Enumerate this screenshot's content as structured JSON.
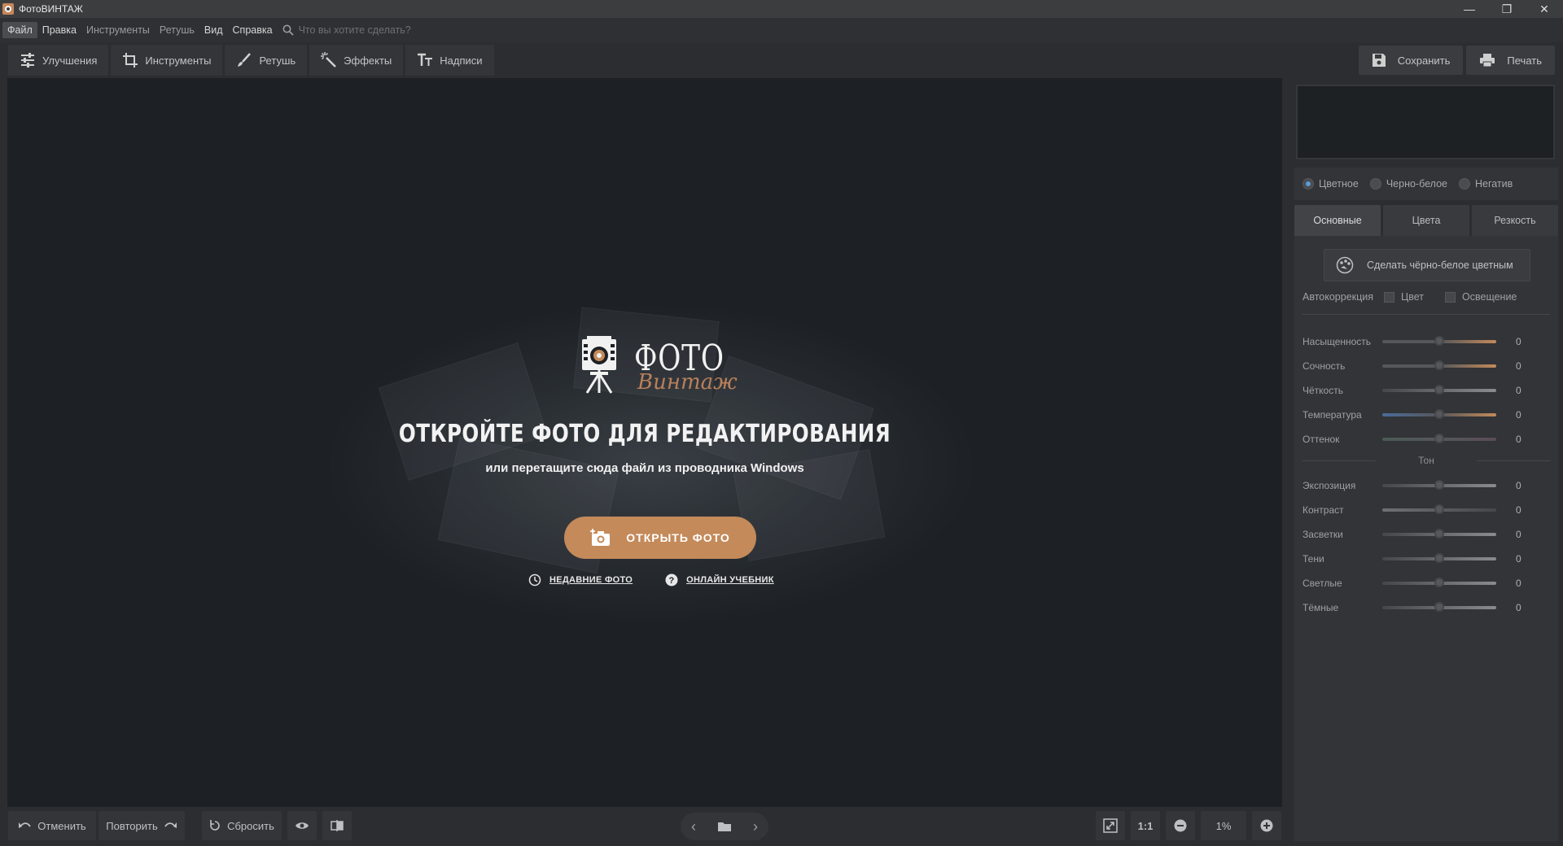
{
  "window": {
    "title": "ФотоВИНТАЖ"
  },
  "menu": {
    "items": [
      "Файл",
      "Правка",
      "Инструменты",
      "Ретушь",
      "Вид",
      "Справка"
    ],
    "search_placeholder": "Что вы хотите сделать?"
  },
  "tabs": [
    "Улучшения",
    "Инструменты",
    "Ретушь",
    "Эффекты",
    "Надписи"
  ],
  "actions": {
    "save": "Сохранить",
    "print": "Печать"
  },
  "welcome": {
    "logo_top": "ФОТО",
    "logo_bottom": "Винтаж",
    "headline": "ОТКРОЙТЕ ФОТО ДЛЯ РЕДАКТИРОВАНИЯ",
    "subline": "или перетащите сюда файл из проводника Windows",
    "open_button": "ОТКРЫТЬ ФОТО",
    "recent_link": "НЕДАВНИЕ ФОТО",
    "tutorial_link": "ОНЛАЙН УЧЕБНИК"
  },
  "bottom": {
    "undo": "Отменить",
    "redo": "Повторить",
    "reset": "Сбросить",
    "ratio": "1:1",
    "zoom": "1%"
  },
  "panel": {
    "modes": [
      "Цветное",
      "Черно-белое",
      "Негатив"
    ],
    "subtabs": [
      "Основные",
      "Цвета",
      "Резкость"
    ],
    "colorize_button": "Сделать чёрно-белое цветным",
    "autocorrection": {
      "label": "Автокоррекция",
      "color": "Цвет",
      "light": "Освещение"
    },
    "sliders_top": [
      {
        "label": "Насыщенность",
        "value": "0"
      },
      {
        "label": "Сочность",
        "value": "0"
      },
      {
        "label": "Чёткость",
        "value": "0"
      },
      {
        "label": "Температура",
        "value": "0"
      },
      {
        "label": "Оттенок",
        "value": "0"
      }
    ],
    "tone_label": "Тон",
    "sliders_tone": [
      {
        "label": "Экспозиция",
        "value": "0"
      },
      {
        "label": "Контраст",
        "value": "0"
      },
      {
        "label": "Засветки",
        "value": "0"
      },
      {
        "label": "Тени",
        "value": "0"
      },
      {
        "label": "Светлые",
        "value": "0"
      },
      {
        "label": "Тёмные",
        "value": "0"
      }
    ]
  },
  "colors": {
    "accent": "#c48a5a",
    "radio_on": "#5b9bd5"
  }
}
